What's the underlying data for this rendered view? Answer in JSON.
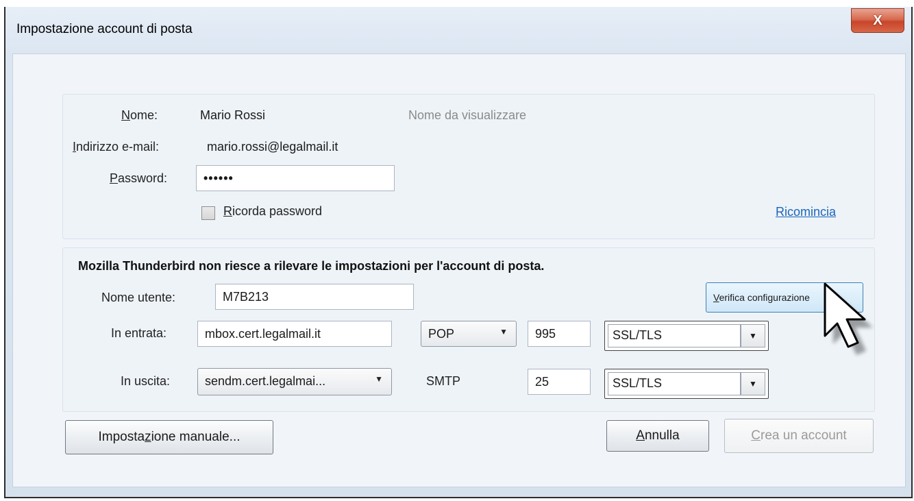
{
  "window": {
    "title": "Impostazione account di posta",
    "close_label": "X"
  },
  "identity": {
    "name_label": "Nome:",
    "name_value": "Mario Rossi",
    "name_hint": "Nome da visualizzare",
    "email_label": "Indirizzo e-mail:",
    "email_value": "mario.rossi@legalmail.it",
    "password_label": "Password:",
    "password_value": "••••••",
    "remember_label": "Ricorda password",
    "restart_link": "Ricomincia"
  },
  "config": {
    "warning": "Mozilla Thunderbird non riesce a rilevare le impostazioni per l'account di posta.",
    "username_label": "Nome utente:",
    "username_value": "M7B213",
    "verify_button": "Verifica configurazione",
    "incoming": {
      "label": "In entrata:",
      "server": "mbox.cert.legalmail.it",
      "protocol": "POP",
      "port": "995",
      "security": "SSL/TLS"
    },
    "outgoing": {
      "label": "In uscita:",
      "server": "sendm.cert.legalmai...",
      "protocol": "SMTP",
      "port": "25",
      "security": "SSL/TLS"
    }
  },
  "buttons": {
    "manual": "Impostazione manuale...",
    "cancel": "Annulla",
    "create": "Crea un account"
  }
}
